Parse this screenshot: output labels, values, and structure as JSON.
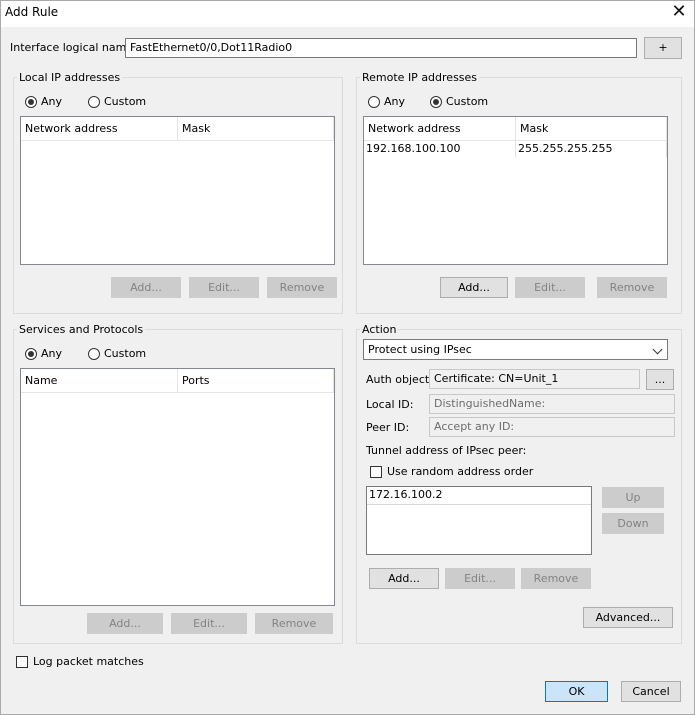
{
  "window": {
    "title": "Add Rule",
    "close_glyph": "✕"
  },
  "interface": {
    "label": "Interface logical name",
    "value": "FastEthernet0/0,Dot11Radio0",
    "plus_label": "+"
  },
  "local_ip": {
    "title": "Local IP addresses",
    "any_label": "Any",
    "custom_label": "Custom",
    "selected": "Any",
    "columns": [
      "Network address",
      "Mask"
    ],
    "rows": [],
    "add_label": "Add...",
    "edit_label": "Edit...",
    "remove_label": "Remove"
  },
  "remote_ip": {
    "title": "Remote IP addresses",
    "any_label": "Any",
    "custom_label": "Custom",
    "selected": "Custom",
    "columns": [
      "Network address",
      "Mask"
    ],
    "rows": [
      {
        "network": "192.168.100.100",
        "mask": "255.255.255.255"
      }
    ],
    "add_label": "Add...",
    "edit_label": "Edit...",
    "remove_label": "Remove"
  },
  "services": {
    "title": "Services and Protocols",
    "any_label": "Any",
    "custom_label": "Custom",
    "selected": "Any",
    "columns": [
      "Name",
      "Ports"
    ],
    "rows": [],
    "add_label": "Add...",
    "edit_label": "Edit...",
    "remove_label": "Remove"
  },
  "action": {
    "title": "Action",
    "selected_action": "Protect using IPsec",
    "auth_label": "Auth object:",
    "auth_value": "Certificate: CN=Unit_1",
    "browse_label": "...",
    "local_id_label": "Local ID:",
    "local_id_placeholder": "DistinguishedName:",
    "peer_id_label": "Peer ID:",
    "peer_id_placeholder": "Accept any ID:",
    "tunnel_label": "Tunnel address of IPsec peer:",
    "random_order_label": "Use random address order",
    "tunnel_addresses": [
      "172.16.100.2"
    ],
    "up_label": "Up",
    "down_label": "Down",
    "add_label": "Add...",
    "edit_label": "Edit...",
    "remove_label": "Remove",
    "advanced_label": "Advanced..."
  },
  "log_label": "Log packet matches",
  "ok_label": "OK",
  "cancel_label": "Cancel",
  "colors": {
    "accent": "#0078d7",
    "primary_bg": "#cce4f7",
    "dialog_bg": "#f0f0f0"
  }
}
